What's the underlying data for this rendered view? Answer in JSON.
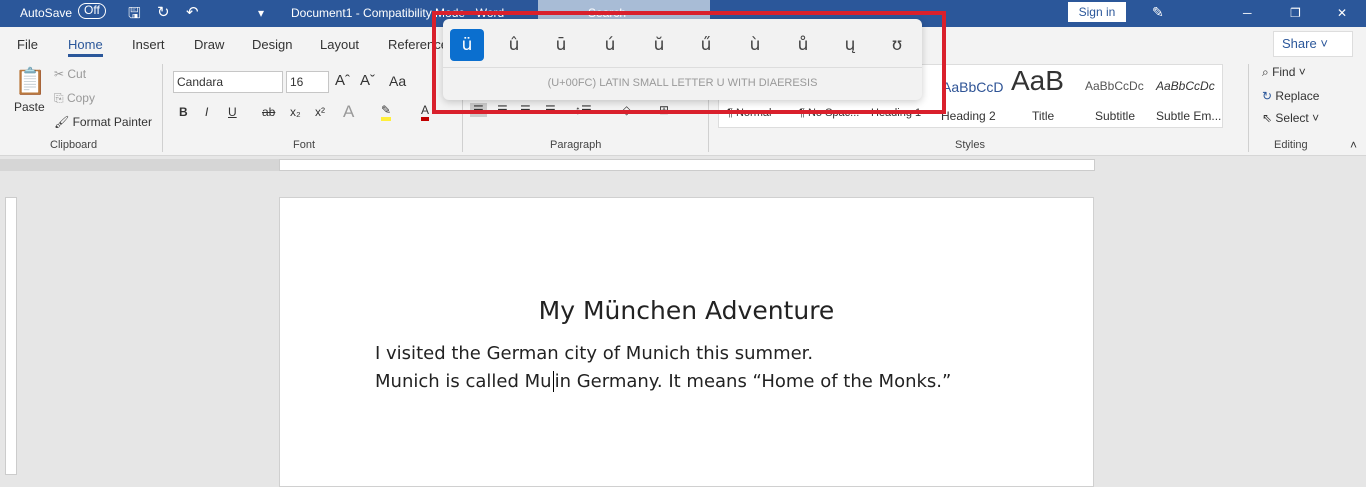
{
  "titlebar": {
    "autosave": "AutoSave",
    "autosave_state": "Off",
    "title": "Document1  -  Compatibility Mode  -  Word",
    "search": "Search",
    "signin": "Sign in"
  },
  "tabs": [
    "File",
    "Home",
    "Insert",
    "Draw",
    "Design",
    "Layout",
    "References"
  ],
  "share": "Share",
  "clipboard": {
    "paste": "Paste",
    "cut": "Cut",
    "copy": "Copy",
    "format_painter": "Format Painter",
    "label": "Clipboard"
  },
  "font": {
    "name": "Candara",
    "size": "16",
    "change_case": "Aa",
    "bold": "B",
    "italic": "I",
    "underline": "U",
    "strike": "ab",
    "sub": "x₂",
    "sup": "x²",
    "label": "Font"
  },
  "paragraph": {
    "label": "Paragraph"
  },
  "styles": {
    "items": [
      "¶ Normal",
      "¶ No Spac...",
      "Heading 1",
      "Heading 2",
      "Title",
      "Subtitle",
      "Subtle Em..."
    ],
    "previews": [
      "AaBbCcD",
      "AaB",
      "AaBbCcDc",
      "AaBbCcDc"
    ],
    "label": "Styles"
  },
  "editing": {
    "find": "Find",
    "replace": "Replace",
    "select": "Select",
    "label": "Editing"
  },
  "popup": {
    "chars": [
      "ü",
      "û",
      "ū",
      "ú",
      "ŭ",
      "ű",
      "ù",
      "ů",
      "ų",
      "ʊ"
    ],
    "selected": 0,
    "description": "(U+00FC) LATIN SMALL LETTER U WITH DIAERESIS"
  },
  "document": {
    "title": "My München Adventure",
    "lines": [
      "I visited the German city of Munich this summer.",
      "Munich is called Mu",
      "in Germany. It means “Home of the Monks.”"
    ]
  },
  "colors": {
    "accent": "#2b579a",
    "highlight": "#d9202c"
  }
}
